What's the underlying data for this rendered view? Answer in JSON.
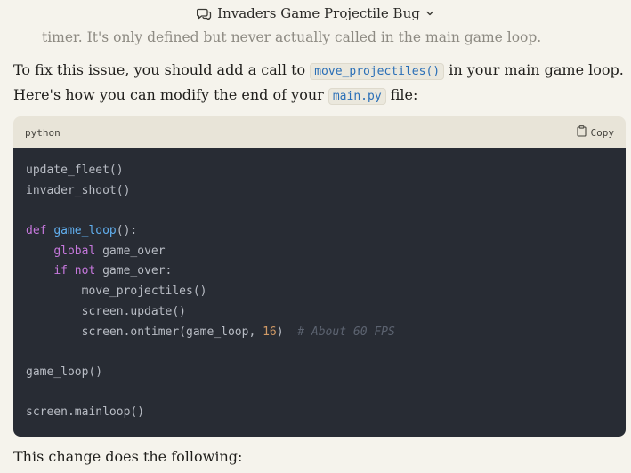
{
  "header": {
    "title": "Invaders Game Projectile Bug"
  },
  "content": {
    "faded_line": "timer. It's only defined but never actually called in the main game loop.",
    "p1_before": "To fix this issue, you should add a call to ",
    "p1_code": "move_projectiles()",
    "p1_after": " in your main game loop.",
    "p2_before": "Here's how you can modify the end of your ",
    "p2_code": "main.py",
    "p2_after": " file:",
    "p3": "This change does the following:"
  },
  "code": {
    "language": "python",
    "copy_label": "Copy",
    "lines": [
      [
        {
          "t": "update_fleet()",
          "c": ""
        }
      ],
      [
        {
          "t": "invader_shoot()",
          "c": ""
        }
      ],
      [],
      [
        {
          "t": "def",
          "c": "kw"
        },
        {
          "t": " ",
          "c": ""
        },
        {
          "t": "game_loop",
          "c": "fn"
        },
        {
          "t": "():",
          "c": ""
        }
      ],
      [
        {
          "t": "    ",
          "c": ""
        },
        {
          "t": "global",
          "c": "kw"
        },
        {
          "t": " game_over",
          "c": ""
        }
      ],
      [
        {
          "t": "    ",
          "c": ""
        },
        {
          "t": "if",
          "c": "kw"
        },
        {
          "t": " ",
          "c": ""
        },
        {
          "t": "not",
          "c": "kw"
        },
        {
          "t": " game_over:",
          "c": ""
        }
      ],
      [
        {
          "t": "        move_projectiles()",
          "c": ""
        }
      ],
      [
        {
          "t": "        screen.update()",
          "c": ""
        }
      ],
      [
        {
          "t": "        screen.ontimer(game_loop, ",
          "c": ""
        },
        {
          "t": "16",
          "c": "num"
        },
        {
          "t": ")  ",
          "c": ""
        },
        {
          "t": "# About 60 FPS",
          "c": "cmt"
        }
      ],
      [],
      [
        {
          "t": "game_loop()",
          "c": ""
        }
      ],
      [],
      [
        {
          "t": "screen.mainloop()",
          "c": ""
        }
      ]
    ]
  },
  "colors": {
    "background": "#f5f3ec",
    "code_background": "#282c34",
    "code_header": "#e8e4d8",
    "keyword": "#c678dd",
    "function": "#61afef",
    "number": "#d19a66",
    "comment": "#5c6370",
    "inline_code": "#2a6fb7"
  },
  "icons": {
    "title_icon": "chat-bubbles-icon",
    "title_chevron": "chevron-down-icon",
    "copy_icon": "clipboard-icon"
  }
}
